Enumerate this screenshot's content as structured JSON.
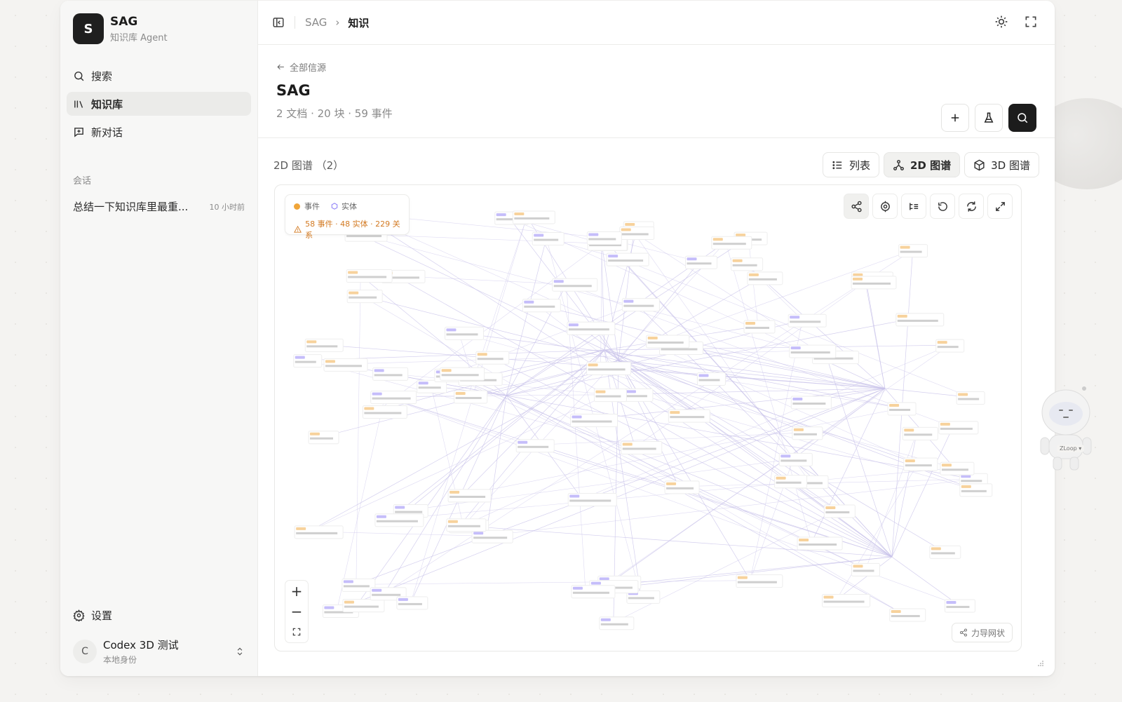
{
  "brand": {
    "logo_letter": "S",
    "title": "SAG",
    "subtitle": "知识库 Agent"
  },
  "nav": [
    {
      "label": "搜索",
      "icon": "search-icon"
    },
    {
      "label": "知识库",
      "icon": "library-icon",
      "active": true
    },
    {
      "label": "新对话",
      "icon": "new-chat-icon"
    }
  ],
  "sessions": {
    "label": "会话",
    "items": [
      {
        "title": "总结一下知识库里最重...",
        "time": "10 小时前"
      }
    ]
  },
  "settings_label": "设置",
  "user": {
    "initial": "C",
    "name": "Codex 3D 测试",
    "role": "本地身份"
  },
  "breadcrumb": {
    "root": "SAG",
    "separator": "›",
    "current": "知识"
  },
  "source": {
    "back_label": "全部信源",
    "title": "SAG",
    "stats": "2 文档 · 20 块 · 59 事件"
  },
  "graph": {
    "section_title": "2D 图谱 （2）",
    "views": [
      {
        "label": "列表",
        "icon": "list-icon"
      },
      {
        "label": "2D 图谱",
        "icon": "graph-2d-icon",
        "active": true
      },
      {
        "label": "3D 图谱",
        "icon": "cube-icon"
      }
    ],
    "legend": {
      "event_label": "事件",
      "entity_label": "实体",
      "stats": "58 事件 · 48 实体 · 229 关系"
    },
    "force_label": "力导网状",
    "zoom_in": "+",
    "zoom_out": "−",
    "colors": {
      "event": "#f0a53a",
      "entity": "#8b7cf6",
      "edge": "#c9c3ea",
      "warning": "#d37a22"
    }
  },
  "robot_badge": "ZLoop ▾"
}
